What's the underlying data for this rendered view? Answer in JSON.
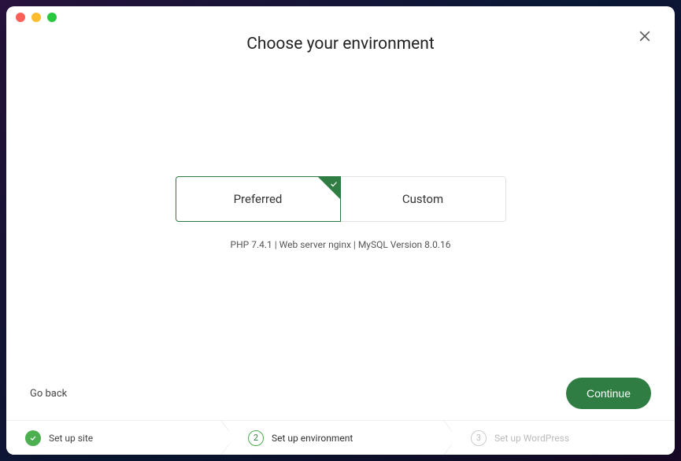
{
  "header": {
    "title": "Choose your environment"
  },
  "options": {
    "preferred_label": "Preferred",
    "custom_label": "Custom",
    "selected": "preferred",
    "spec_line": "PHP 7.4.1 | Web server nginx | MySQL Version 8.0.16"
  },
  "footer": {
    "go_back_label": "Go back",
    "continue_label": "Continue"
  },
  "steps": {
    "items": [
      {
        "label": "Set up site",
        "state": "done"
      },
      {
        "label": "Set up environment",
        "state": "active",
        "number": "2"
      },
      {
        "label": "Set up WordPress",
        "state": "pending",
        "number": "3"
      }
    ]
  },
  "colors": {
    "accent": "#2f7d42"
  }
}
